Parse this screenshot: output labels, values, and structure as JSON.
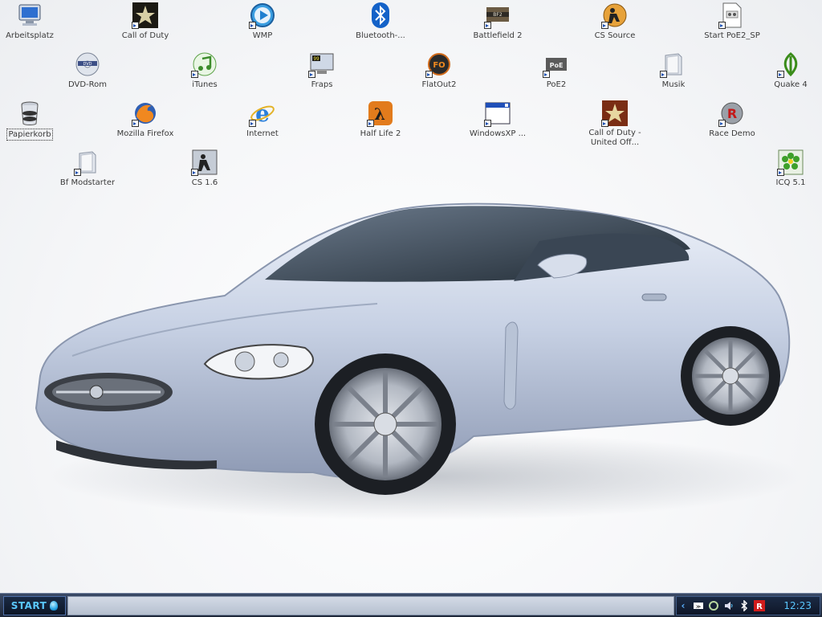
{
  "desktop": {
    "icons": [
      {
        "label": "Arbeitsplatz",
        "icon": "my-computer-icon"
      },
      {
        "label": "Call of Duty",
        "icon": "call-of-duty-icon"
      },
      {
        "label": "WMP",
        "icon": "windows-media-player-icon"
      },
      {
        "label": "Bluetooth-...",
        "icon": "bluetooth-icon"
      },
      {
        "label": "Battlefield 2",
        "icon": "battlefield-icon"
      },
      {
        "label": "CS Source",
        "icon": "counter-strike-source-icon"
      },
      {
        "label": "Start PoE2_SP",
        "icon": "batch-file-icon"
      },
      {
        "label": "DVD-Rom",
        "icon": "dvd-drive-icon"
      },
      {
        "label": "iTunes",
        "icon": "itunes-icon"
      },
      {
        "label": "Fraps",
        "icon": "fraps-icon"
      },
      {
        "label": "FlatOut2",
        "icon": "flatout-icon"
      },
      {
        "label": "PoE2",
        "icon": "poe2-icon"
      },
      {
        "label": "Musik",
        "icon": "folder-icon"
      },
      {
        "label": "Quake 4",
        "icon": "quake-icon"
      },
      {
        "label": "Papierkorb",
        "icon": "recycle-bin-icon"
      },
      {
        "label": "Mozilla Firefox",
        "icon": "firefox-icon"
      },
      {
        "label": "Internet",
        "icon": "internet-explorer-icon"
      },
      {
        "label": "Half Life 2",
        "icon": "half-life-icon"
      },
      {
        "label": "WindowsXP ...",
        "icon": "window-icon"
      },
      {
        "label": "Call of Duty - United Off...",
        "icon": "call-of-duty-united-offensive-icon"
      },
      {
        "label": "Race Demo",
        "icon": "race-icon"
      },
      {
        "label": "Bf Modstarter",
        "icon": "folder-icon"
      },
      {
        "label": "CS 1.6",
        "icon": "counter-strike-icon"
      },
      {
        "label": "ICQ 5.1",
        "icon": "icq-icon"
      }
    ]
  },
  "taskbar": {
    "start_label": "START",
    "tray_icons": [
      "network-icon",
      "recycle-icon",
      "speaker-icon",
      "bluetooth-icon",
      "antivirus-icon"
    ],
    "clock": "12:23"
  },
  "colors": {
    "taskbar_dark": "#1e2738",
    "accent": "#5ac8ff",
    "task_area": "#c4ccd9"
  }
}
